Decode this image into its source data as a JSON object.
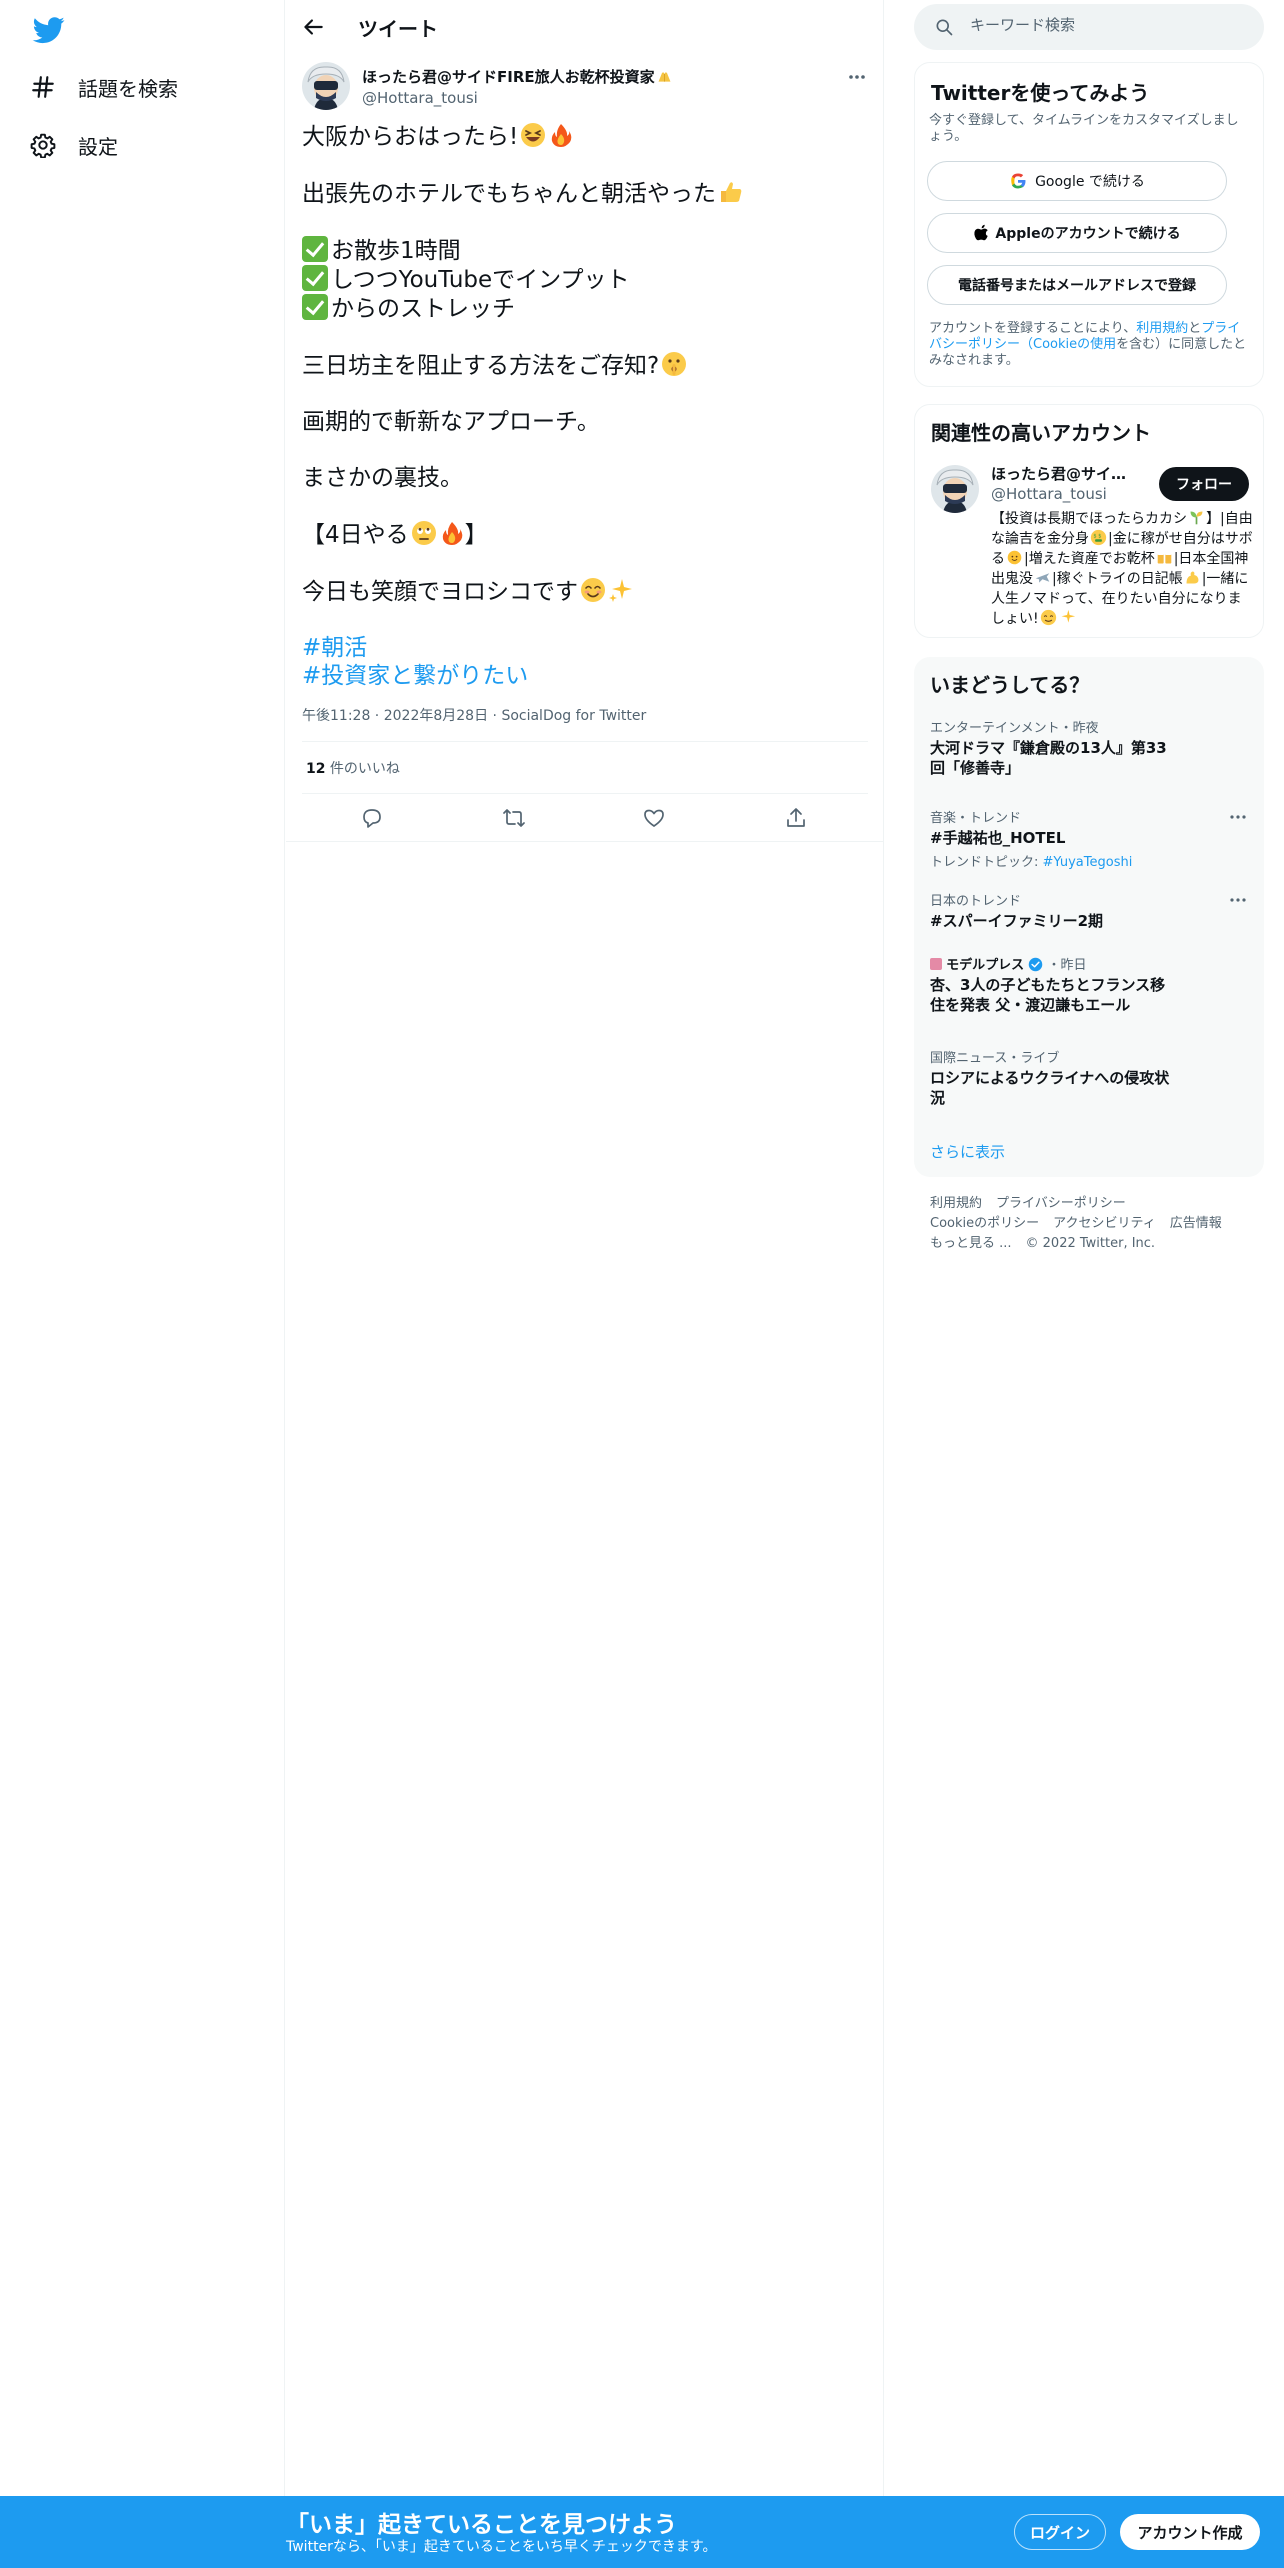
{
  "colors": {
    "accent": "#1d9bf0",
    "text": "#0f1419",
    "muted": "#536471",
    "border": "#eff3f4",
    "bottom_bar": "#1d9bf0"
  },
  "nav": {
    "logo_icon": "twitter-bird-icon",
    "items": [
      {
        "label": "話題を検索",
        "icon": "hashtag-icon"
      },
      {
        "label": "設定",
        "icon": "gear-icon"
      }
    ]
  },
  "header": {
    "title": "ツイート",
    "back_icon": "arrow-left-icon"
  },
  "tweet": {
    "author_name": "ほったら君@サイドFIRE旅人お乾杯投資家",
    "author_handle": "@Hottara_tousi",
    "lines": {
      "l1": "大阪からおはったら!",
      "l2": "出張先のホテルでもちゃんと朝活やった",
      "l3a": "お散歩1時間",
      "l3b": "しつつYouTubeでインプット",
      "l3c": "からのストレッチ",
      "l4": "三日坊主を阻止する方法をご存知?",
      "l5": "画期的で斬新なアプローチ。",
      "l6": "まさかの裏技。",
      "l7a": "【4日やる",
      "l7b": "】",
      "l8": "今日も笑顔でヨロシコです"
    },
    "hashtags": [
      "#朝活",
      "#投資家と繋がりたい"
    ],
    "time": "午後11:28",
    "date": "2022年8月28日",
    "source": "SocialDog for Twitter",
    "likes_count": "12",
    "likes_label": " 件のいいね",
    "actions": [
      "reply-icon",
      "retweet-icon",
      "like-icon",
      "share-icon"
    ]
  },
  "search": {
    "placeholder": "キーワード検索"
  },
  "signup_card": {
    "title": "Twitterを使ってみよう",
    "desc": "今すぐ登録して、タイムラインをカスタマイズしましょう。",
    "google_label": "Google で続ける",
    "apple_label": "Appleのアカウントで続ける",
    "phone_label": "電話番号またはメールアドレスで登録",
    "legal_pre": "アカウントを登録することにより、",
    "legal_terms": "利用規約",
    "legal_and": "と",
    "legal_privacy": "プライバシーポリシー",
    "legal_paren_open": "（",
    "legal_cookie": "Cookieの使用",
    "legal_post": "を含む）に同意したとみなされます。"
  },
  "related_card": {
    "title": "関連性の高いアカウント",
    "name": "ほったら君@サイドFIRE旅人お乾杯投資家",
    "handle": "@Hottara_tousi",
    "follow_label": "フォロー",
    "bio": {
      "b1": "【投資は長期でほったらカカシ",
      "b2": "】|自由な論吉を金分身",
      "b3": "|金に稼がせ自分はサボる",
      "b4": "|増えた資産でお乾杯",
      "b5": "|日本全国神出鬼没",
      "b6": "|稼ぐトライの日記帳",
      "b7": "|一緒に人生ノマドって、在りたい自分になりましょい!"
    }
  },
  "trends": {
    "title": "いまどうしてる？",
    "items": [
      {
        "meta": "エンターテインメント・昨夜",
        "title": "大河ドラマ『鎌倉殿の13人』第33回「修善寺」"
      },
      {
        "meta": "音楽・トレンド",
        "title": "#手越祐也_HOTEL",
        "sub_label": "トレンドトピック: ",
        "sub_link": "#YuyaTegoshi"
      },
      {
        "meta": "日本のトレンド",
        "title": "#スパーイファミリー2期"
      },
      {
        "meta_source": "モデルプレス",
        "meta_time": "・昨日",
        "title": "杏、3人の子どもたちとフランス移住を発表 父・渡辺謙もエール"
      },
      {
        "meta": "国際ニュース・ライブ",
        "title": "ロシアによるウクライナへの侵攻状況"
      }
    ],
    "show_more": "さらに表示"
  },
  "footer": {
    "links": [
      "利用規約",
      "プライバシーポリシー",
      "Cookieのポリシー",
      "アクセシビリティ",
      "広告情報",
      "もっと見る ..."
    ],
    "copyright": "© 2022 Twitter, Inc."
  },
  "bottom_bar": {
    "title": "「いま」起きていることを見つけよう",
    "subtitle": "Twitterなら、「いま」起きていることをいち早くチェックできます。",
    "login_label": "ログイン",
    "signup_label": "アカウント作成"
  }
}
